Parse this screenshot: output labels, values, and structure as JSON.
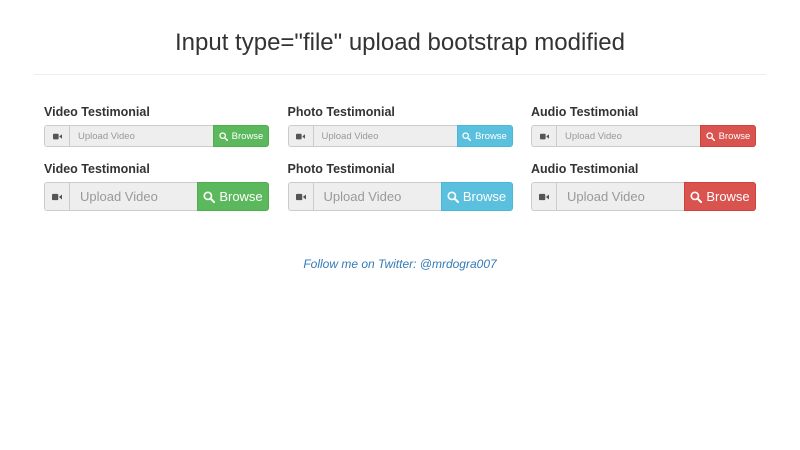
{
  "page": {
    "title": "Input type=\"file\" upload bootstrap modified"
  },
  "colors": {
    "success": "#5cb85c",
    "info": "#5bc0de",
    "danger": "#d9534f",
    "link": "#337ab7"
  },
  "icons": {
    "addon": "video-camera-icon",
    "button": "search-icon"
  },
  "rows": [
    {
      "size": "small",
      "items": [
        {
          "label": "Video Testimonial",
          "placeholder": "Upload Video",
          "button": "Browse",
          "variant": "success"
        },
        {
          "label": "Photo Testimonial",
          "placeholder": "Upload Video",
          "button": "Browse",
          "variant": "info"
        },
        {
          "label": "Audio Testimonial",
          "placeholder": "Upload Video",
          "button": "Browse",
          "variant": "danger"
        }
      ]
    },
    {
      "size": "large",
      "items": [
        {
          "label": "Video Testimonial",
          "placeholder": "Upload Video",
          "button": "Browse",
          "variant": "success"
        },
        {
          "label": "Photo Testimonial",
          "placeholder": "Upload Video",
          "button": "Browse",
          "variant": "info"
        },
        {
          "label": "Audio Testimonial",
          "placeholder": "Upload Video",
          "button": "Browse",
          "variant": "danger"
        }
      ]
    }
  ],
  "footer": {
    "link_text": "Follow me on Twitter: @mrdogra007"
  }
}
